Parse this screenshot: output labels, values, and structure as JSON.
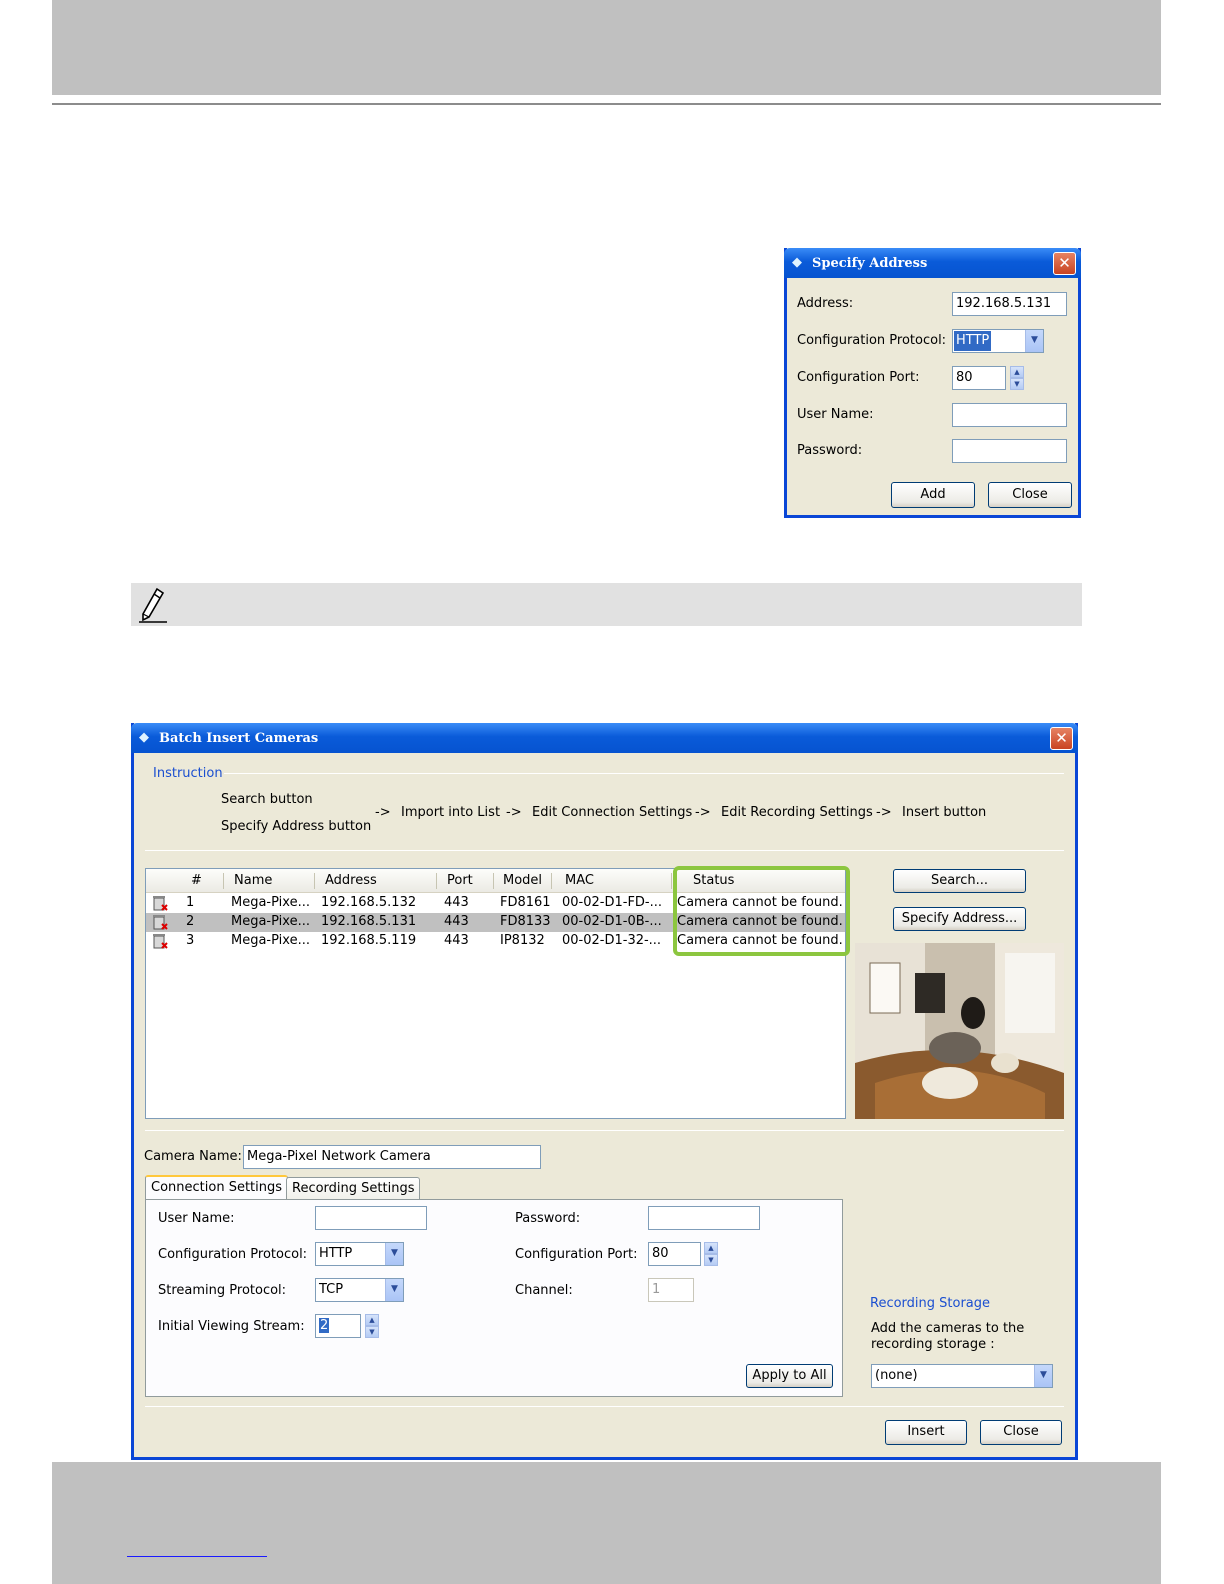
{
  "specify_address_dialog": {
    "title": "Specify Address",
    "address_label": "Address:",
    "address_value": "192.168.5.131",
    "protocol_label": "Configuration Protocol:",
    "protocol_value": "HTTP",
    "port_label": "Configuration Port:",
    "port_value": "80",
    "username_label": "User Name:",
    "username_value": "",
    "password_label": "Password:",
    "password_value": "",
    "add_button": "Add",
    "close_button": "Close"
  },
  "batch_dialog": {
    "title": "Batch Insert Cameras",
    "instruction": {
      "heading": "Instruction",
      "search_step": "Search button",
      "specify_step": "Specify Address button",
      "arrow": "->",
      "import_step": "Import into List",
      "edit_conn_step": "Edit Connection Settings",
      "edit_rec_step": "Edit Recording Settings",
      "insert_step": "Insert button"
    },
    "columns": [
      "#",
      "Name",
      "Address",
      "Port",
      "Model",
      "MAC",
      "Status"
    ],
    "rows": [
      {
        "num": "1",
        "name": "Mega-Pixe...",
        "address": "192.168.5.132",
        "port": "443",
        "model": "FD8161",
        "mac": "00-02-D1-FD-...",
        "status": "Camera cannot be found.",
        "selected": false
      },
      {
        "num": "2",
        "name": "Mega-Pixe...",
        "address": "192.168.5.131",
        "port": "443",
        "model": "FD8133",
        "mac": "00-02-D1-0B-...",
        "status": "Camera cannot be found.",
        "selected": true
      },
      {
        "num": "3",
        "name": "Mega-Pixe...",
        "address": "192.168.5.119",
        "port": "443",
        "model": "IP8132",
        "mac": "00-02-D1-32-...",
        "status": "Camera cannot be found.",
        "selected": false
      }
    ],
    "search_button": "Search...",
    "specify_button": "Specify Address...",
    "camera_name_label": "Camera Name:",
    "camera_name_value": "Mega-Pixel Network Camera",
    "tabs": [
      "Connection Settings",
      "Recording Settings"
    ],
    "connection": {
      "username_label": "User Name:",
      "username_value": "",
      "password_label": "Password:",
      "password_value": "",
      "config_protocol_label": "Configuration Protocol:",
      "config_protocol_value": "HTTP",
      "config_port_label": "Configuration Port:",
      "config_port_value": "80",
      "streaming_protocol_label": "Streaming Protocol:",
      "streaming_protocol_value": "TCP",
      "channel_label": "Channel:",
      "channel_value": "1",
      "initial_stream_label": "Initial Viewing Stream:",
      "initial_stream_value": "2",
      "apply_all_button": "Apply to All"
    },
    "recording_storage": {
      "heading": "Recording Storage",
      "description": "Add the cameras to the recording storage :",
      "value": "(none)"
    },
    "insert_button": "Insert",
    "close_button": "Close"
  },
  "colors": {
    "title_blue": "#0a5bd9",
    "highlight_green": "#8cc63f",
    "dialog_bg": "#ece9d8",
    "gray_band": "#c0c0c0"
  }
}
